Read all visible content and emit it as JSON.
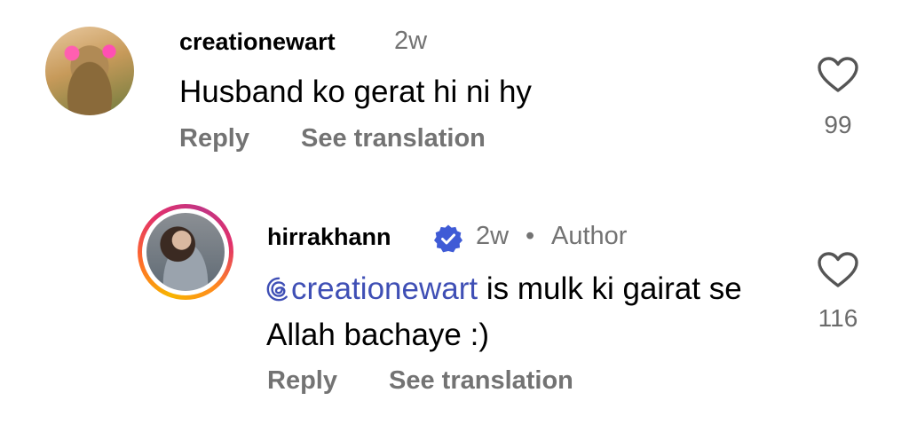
{
  "comments": [
    {
      "username": "creationewart",
      "time": "2w",
      "text": "Husband ko gerat hi ni hy",
      "reply_label": "Reply",
      "translate_label": "See translation",
      "likes": "99"
    },
    {
      "username": "hirrakhann",
      "verified": true,
      "time": "2w",
      "separator": "•",
      "author_label": "Author",
      "mention": "creationewart",
      "text_after_mention": " is mulk ki gairat se Allah bachaye :)",
      "reply_label": "Reply",
      "translate_label": "See translation",
      "likes": "116"
    }
  ],
  "icons": {
    "like": "heart-outline-icon",
    "verified": "verified-badge-icon",
    "mention": "threads-at-icon"
  },
  "colors": {
    "secondary_text": "#737373",
    "mention": "#3f4fb5",
    "verified": "#3f5bd6"
  }
}
